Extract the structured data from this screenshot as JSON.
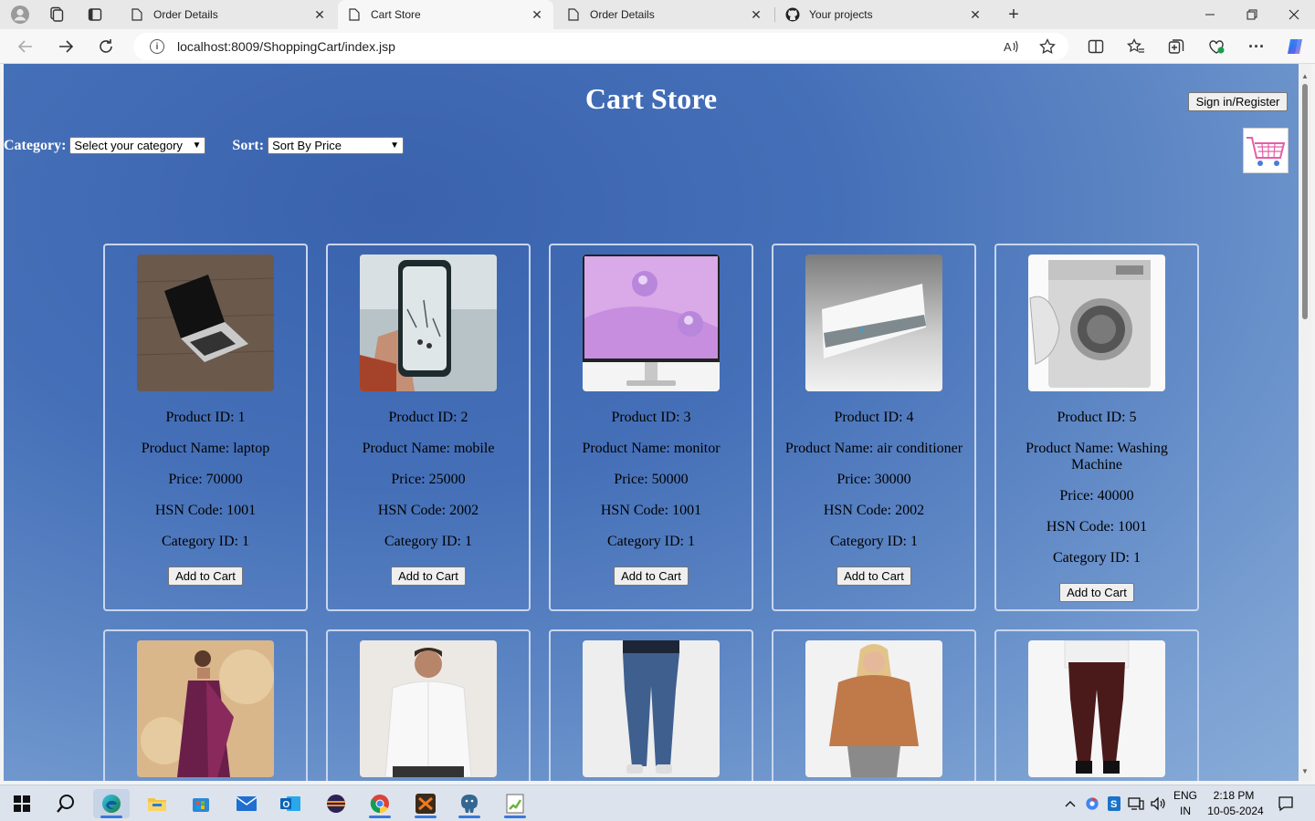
{
  "browser": {
    "tabs": [
      {
        "title": "Order Details",
        "active": false
      },
      {
        "title": "Cart Store",
        "active": true
      },
      {
        "title": "Order Details",
        "active": false
      },
      {
        "title": "Your projects",
        "active": false
      }
    ],
    "url": "localhost:8009/ShoppingCart/index.jsp"
  },
  "page": {
    "title": "Cart Store",
    "signin_label": "Sign in/Register",
    "category_label": "Category:",
    "category_value": "Select your category",
    "sort_label": "Sort:",
    "sort_value": "Sort By Price",
    "add_to_cart_label": "Add to Cart"
  },
  "products": [
    {
      "id": "Product ID: 1",
      "name": "Product Name: laptop",
      "price": "Price: 70000",
      "hsn": "HSN Code: 1001",
      "category": "Category ID: 1",
      "image": "laptop"
    },
    {
      "id": "Product ID: 2",
      "name": "Product Name: mobile",
      "price": "Price: 25000",
      "hsn": "HSN Code: 2002",
      "category": "Category ID: 1",
      "image": "mobile"
    },
    {
      "id": "Product ID: 3",
      "name": "Product Name: monitor",
      "price": "Price: 50000",
      "hsn": "HSN Code: 1001",
      "category": "Category ID: 1",
      "image": "monitor"
    },
    {
      "id": "Product ID: 4",
      "name": "Product Name: air conditioner",
      "price": "Price: 30000",
      "hsn": "HSN Code: 2002",
      "category": "Category ID: 1",
      "image": "air-conditioner"
    },
    {
      "id": "Product ID: 5",
      "name": "Product Name: Washing Machine",
      "price": "Price: 40000",
      "hsn": "HSN Code: 1001",
      "category": "Category ID: 1",
      "image": "washing-machine"
    }
  ],
  "products_row2_images": [
    "saree",
    "white-shirt",
    "jeans",
    "hoodie",
    "trousers"
  ],
  "taskbar": {
    "language": "ENG",
    "region": "IN",
    "time": "2:18 PM",
    "date": "10-05-2024"
  },
  "colors": {
    "page_bg": "#4570b8",
    "card_border": "#c8d6ee",
    "title_text": "#ffffff"
  }
}
